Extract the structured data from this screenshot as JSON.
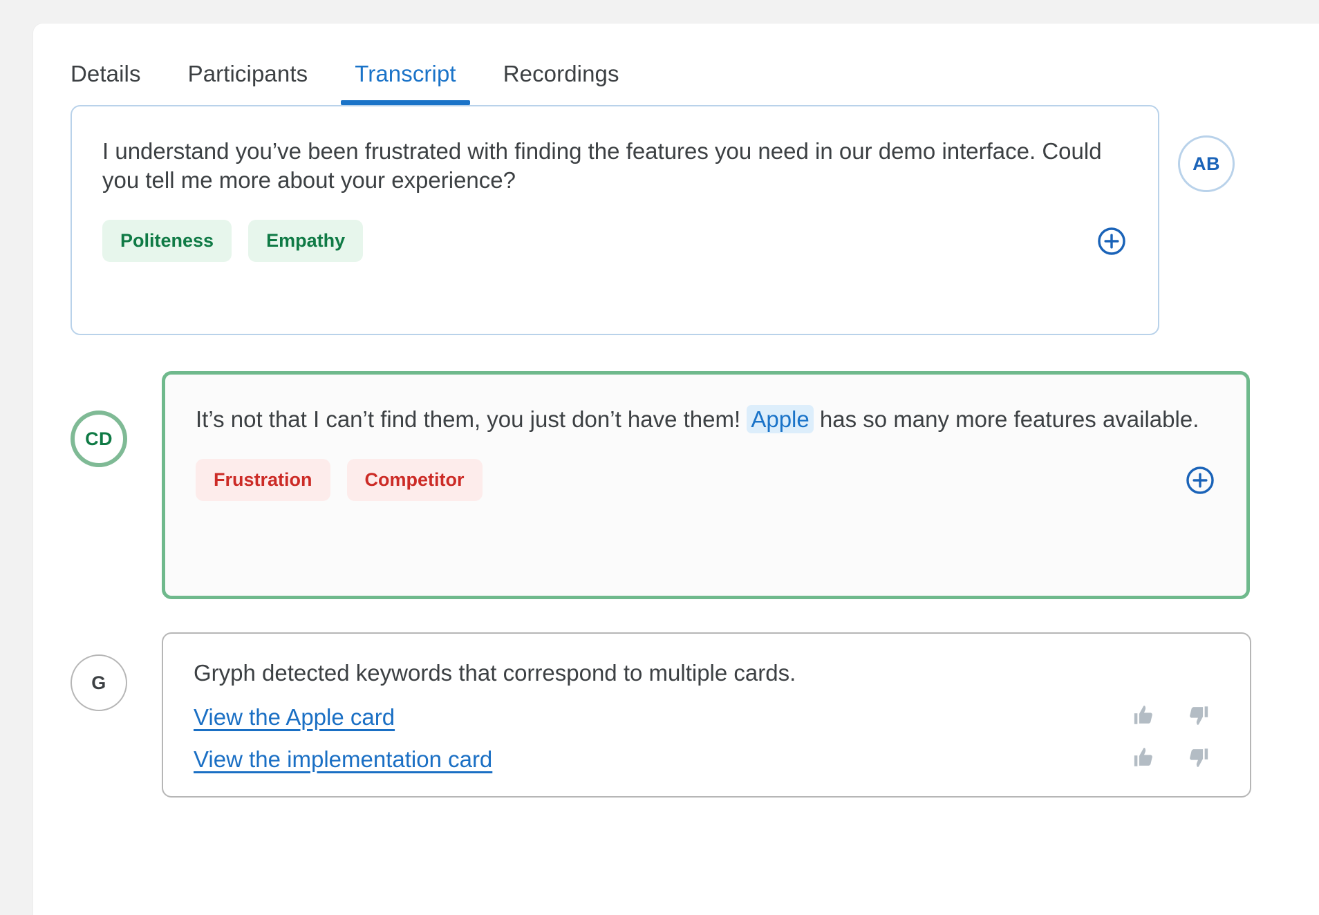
{
  "tabs": [
    {
      "label": "Details",
      "active": false
    },
    {
      "label": "Participants",
      "active": false
    },
    {
      "label": "Transcript",
      "active": true
    },
    {
      "label": "Recordings",
      "active": false
    }
  ],
  "colors": {
    "accent_blue": "#1a73c8",
    "tag_green_text": "#0f7a45",
    "tag_green_bg": "#e7f6ec",
    "tag_red_text": "#cc2b26",
    "tag_red_bg": "#fdeceb",
    "highlight_bg": "#ddeefb",
    "speaker_active_border": "#6fb98c"
  },
  "messages": [
    {
      "avatar": "AB",
      "avatar_style": "blue",
      "text_before": "I understand you’ve been frustrated with finding the features you need in our demo interface. Could you tell me more about your experience?",
      "tags": [
        {
          "label": "Politeness",
          "tone": "green"
        },
        {
          "label": "Empathy",
          "tone": "green"
        }
      ],
      "add_tag_icon": "plus-circle-icon"
    },
    {
      "avatar": "CD",
      "avatar_style": "green",
      "text_before": "It’s not that I can’t find them, you just don’t have them! ",
      "keyword": "Apple",
      "text_after": " has so many more features available.",
      "tags": [
        {
          "label": "Frustration",
          "tone": "red"
        },
        {
          "label": "Competitor",
          "tone": "red"
        }
      ],
      "add_tag_icon": "plus-circle-icon"
    }
  ],
  "system_message": {
    "avatar": "G",
    "avatar_style": "grey",
    "text": "Gryph detected keywords that correspond to multiple cards.",
    "links": [
      {
        "label": "View the Apple card",
        "thumbs_up_icon": "thumbs-up-icon",
        "thumbs_down_icon": "thumbs-down-icon"
      },
      {
        "label": "View the implementation card",
        "thumbs_up_icon": "thumbs-up-icon",
        "thumbs_down_icon": "thumbs-down-icon"
      }
    ]
  }
}
